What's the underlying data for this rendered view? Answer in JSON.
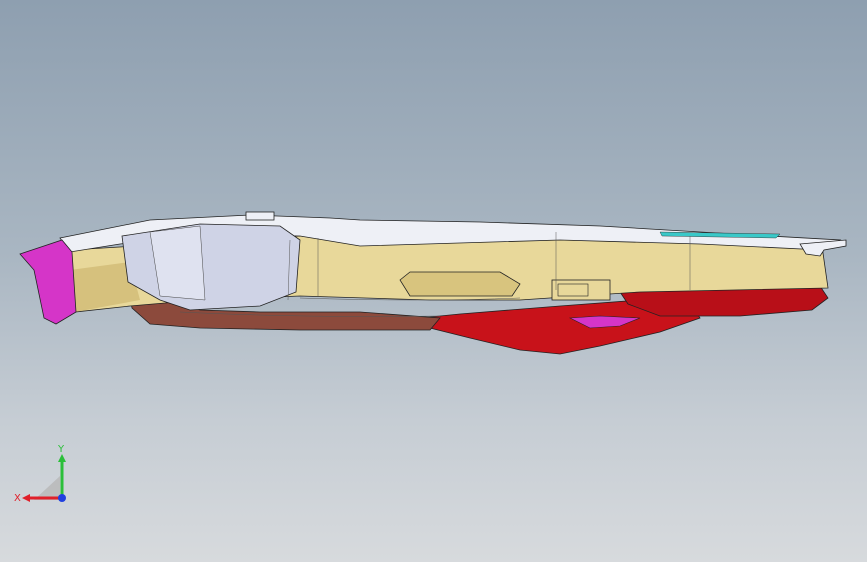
{
  "viewport": {
    "background_top": "#8e9fb0",
    "background_bottom": "#d7dadd"
  },
  "model": {
    "colors": {
      "body": "#e8d89a",
      "body_shade": "#c9b26a",
      "top_plate": "#eef0f6",
      "housing": "#cfd3e6",
      "end_cap": "#d535c8",
      "base": "#8c4a3c",
      "underside": "#c8121a",
      "accent": "#3ac8c8",
      "edges": "#222222"
    }
  },
  "triad": {
    "x_label": "X",
    "y_label": "Y",
    "x_color": "#e0202a",
    "y_color": "#2bbf3a",
    "z_color": "#2040e0"
  }
}
